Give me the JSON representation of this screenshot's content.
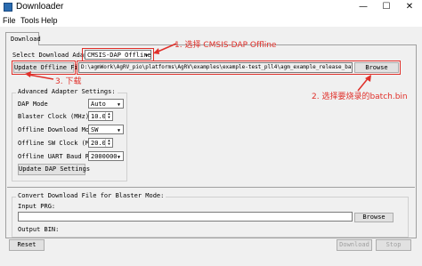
{
  "window": {
    "title": "Downloader",
    "minimize": "—",
    "maximize": "☐",
    "close": "✕"
  },
  "menu": {
    "file": "File",
    "tools": "Tools",
    "help": "Help"
  },
  "tab": {
    "label": "Download"
  },
  "adapter": {
    "label": "Select Download Adapter",
    "value": "CMSIS-DAP Offline"
  },
  "update_file": {
    "button": "Update Offline File",
    "path": "D:\\agmWork\\AgRV_pio\\platforms\\AgRV\\examples\\example-test_pll4\\agm_example_release_batch.bin",
    "browse": "Browse"
  },
  "advanced": {
    "title": "Advanced Adapter Settings:",
    "dap_mode_label": "DAP Mode",
    "dap_mode_value": "Auto",
    "blaster_clock_label": "Blaster Clock (MHz)",
    "blaster_clock_value": "10.0",
    "offline_mode_label": "Offline Download Mode",
    "offline_mode_value": "SW",
    "offline_sw_clock_label": "Offline SW Clock (MHz)",
    "offline_sw_clock_value": "20.0",
    "offline_uart_label": "Offline UART Baud Rate",
    "offline_uart_value": "2000000",
    "update_button": "Update DAP Settings"
  },
  "convert": {
    "title": "Convert Download File for Blaster Mode:",
    "input_label": "Input PRG:",
    "input_value": "",
    "browse": "Browse",
    "output_label": "Output BIN:"
  },
  "bottom": {
    "reset": "Reset",
    "download": "Download",
    "stop": "Stop"
  },
  "annotations": {
    "step1": "1. 选择 CMSIS-DAP Offline",
    "step2": "2. 选择要烧录的batch.bin",
    "step3": "3. 下载"
  },
  "colors": {
    "annotation": "#e0302a"
  }
}
